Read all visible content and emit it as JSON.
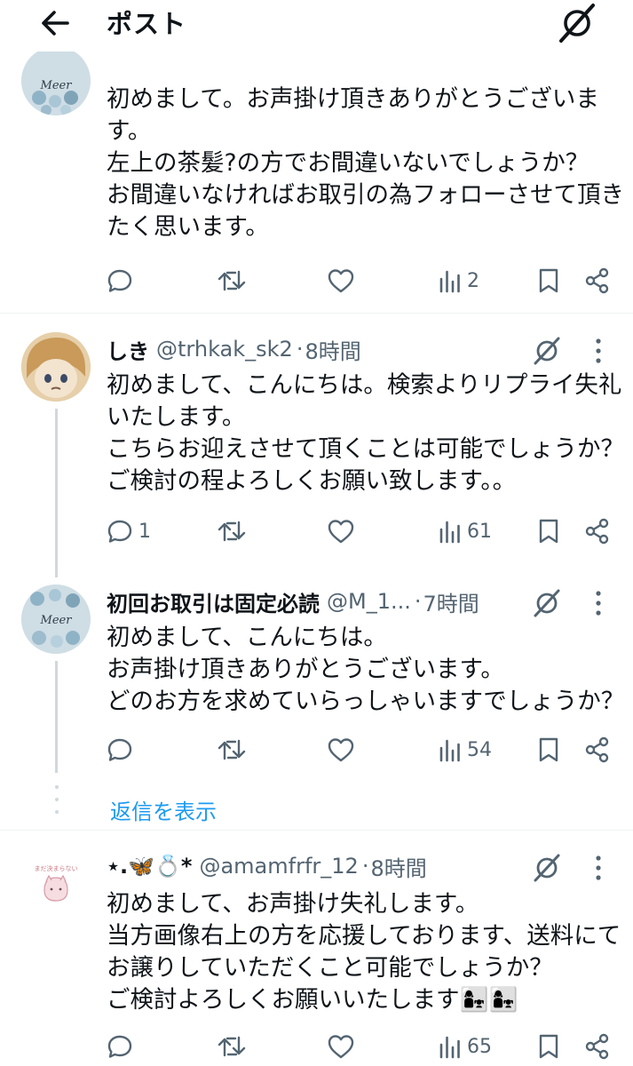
{
  "header": {
    "title": "ポスト"
  },
  "tweets": [
    {
      "avatar_text": "Meer",
      "lines": [
        "初めまして。お声掛け頂きありがとうございま",
        "す。",
        "左上の茶髪?の方でお間違いないでしょうか？",
        "お間違いなければお取引の為フォローさせて頂き",
        "たく思います。"
      ],
      "replies": "",
      "views": "2"
    },
    {
      "name": "しき",
      "handle": "@trhkak_sk2",
      "sep": "·",
      "time": "8時間",
      "lines": [
        "初めまして、こんにちは。検索よりリプライ失礼",
        "いたします。",
        "こちらお迎えさせて頂くことは可能でしょうか？",
        "ご検討の程よろしくお願い致します。。"
      ],
      "replies": "1",
      "views": "61"
    },
    {
      "avatar_text": "Meer",
      "name": "初回お取引は固定必読",
      "handle": "@M_1...",
      "sep": "·",
      "time": "7時間",
      "lines": [
        "初めまして、こんにちは。",
        "お声掛け頂きありがとうございます。",
        "どのお方を求めていらっしゃいますでしょうか？"
      ],
      "replies": "",
      "views": "54"
    },
    {
      "avatar_text": "まだ決まらない",
      "name": "⋆.🦋💍*",
      "handle": "@amamfrfr_12",
      "sep": "·",
      "time": "8時間",
      "lines": [
        "初めまして、お声掛け失礼します。",
        "当方画像右上の方を応援しております、送料にて",
        "お譲りしていただくこと可能でしょうか？",
        "ご検討よろしくお願いいたします👩‍👧👩‍👧"
      ],
      "replies": "",
      "views": "65"
    }
  ],
  "show_replies_label": "返信を表示",
  "icons": {
    "back": "arrow-left-icon",
    "grok": "grok-icon",
    "reply": "reply-icon",
    "repost": "repost-icon",
    "like": "heart-icon",
    "views": "views-icon",
    "bookmark": "bookmark-icon",
    "share": "share-icon"
  },
  "colors": {
    "link": "#1d9bf0",
    "secondary": "#536471",
    "thread_line": "#cfd9de"
  }
}
